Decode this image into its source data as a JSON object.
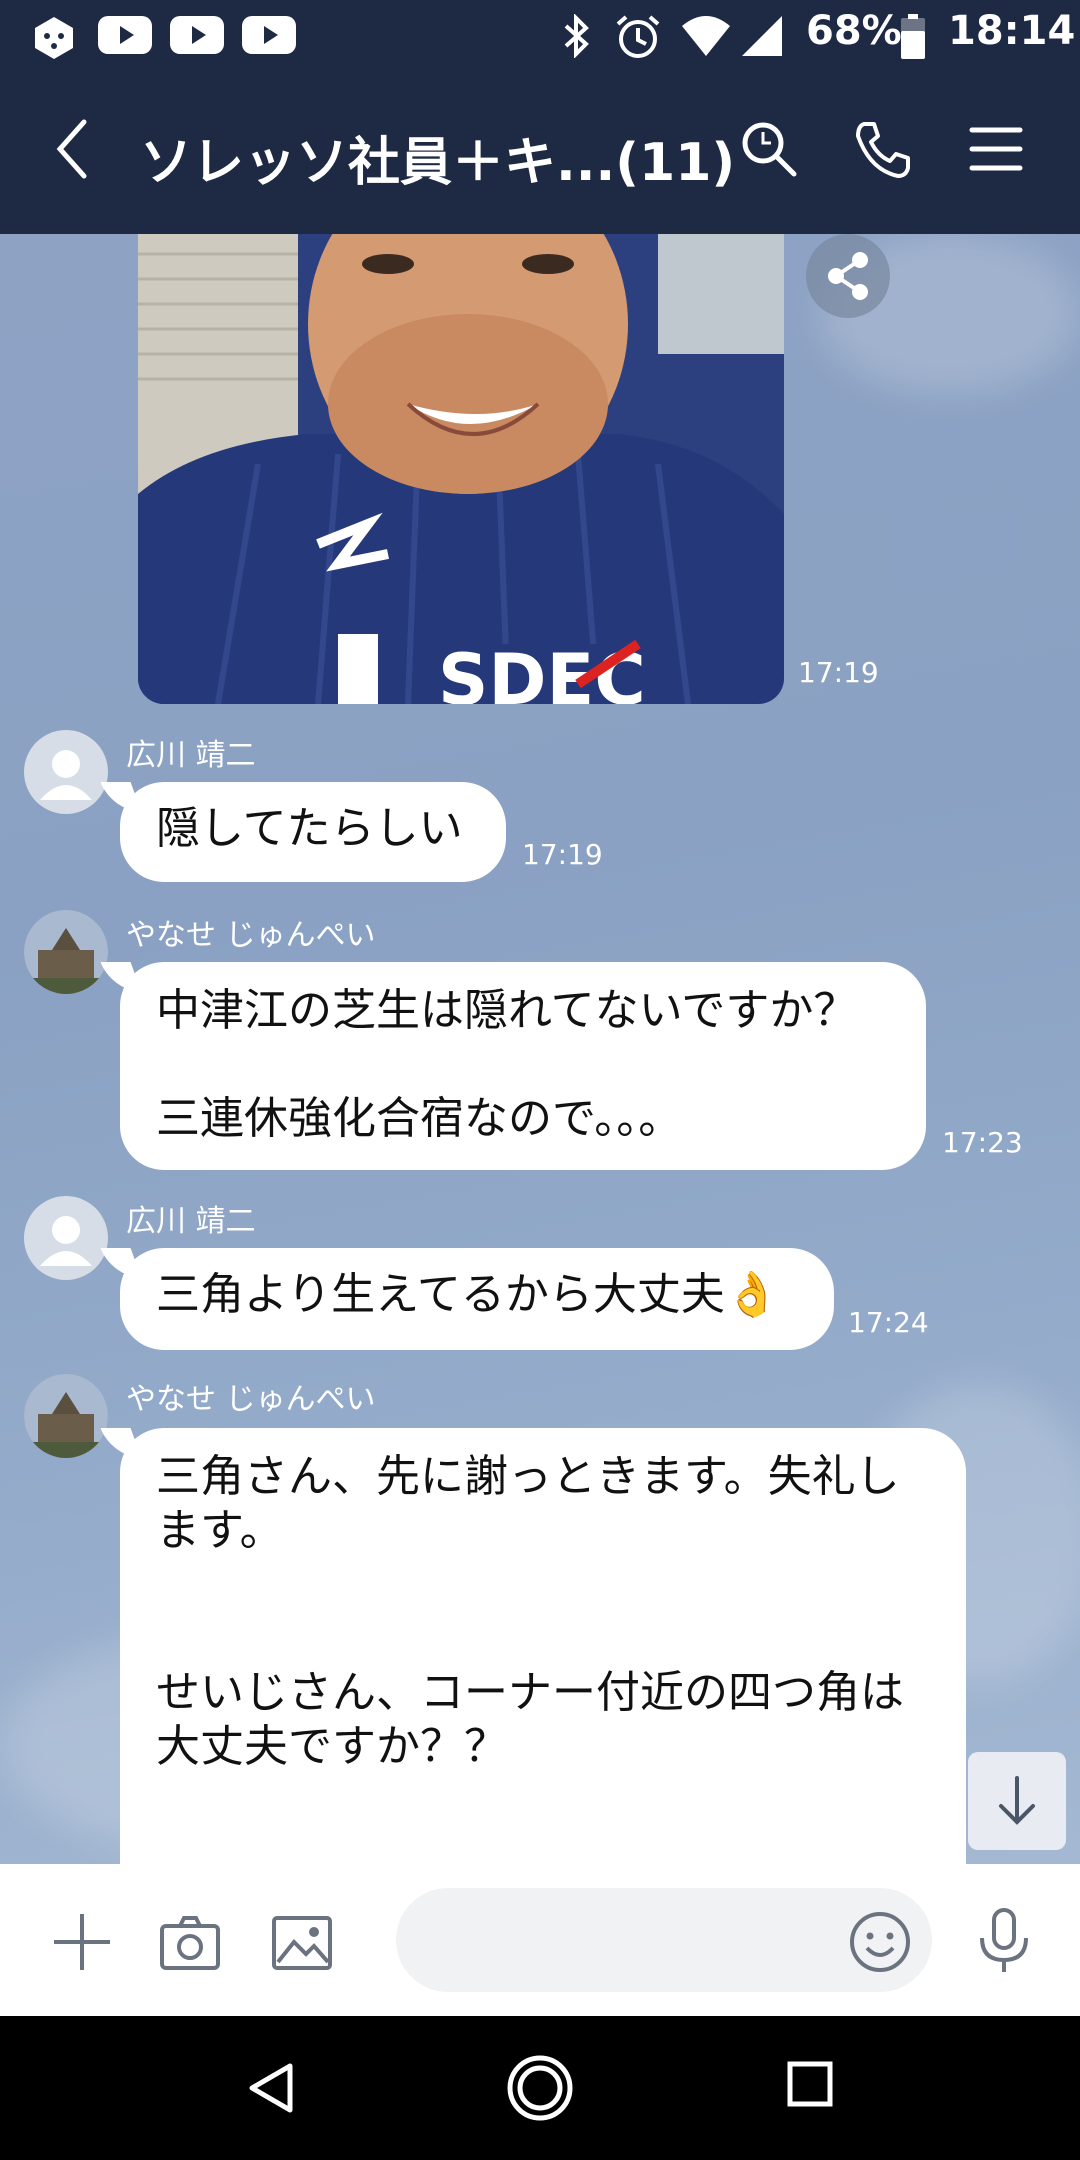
{
  "status_bar": {
    "battery_percent": "68%",
    "time": "18:14",
    "icons": [
      "app-icon",
      "youtube-icon",
      "youtube-icon",
      "youtube-icon",
      "bluetooth-icon",
      "alarm-icon",
      "wifi-icon",
      "signal-icon",
      "battery-icon"
    ]
  },
  "header": {
    "title": "ソレッソ社員＋キ...(11)",
    "icons": [
      "back-icon",
      "search-icon",
      "phone-icon",
      "menu-icon"
    ]
  },
  "messages": [
    {
      "type": "image",
      "time": "17:19"
    },
    {
      "sender": "広川 靖二",
      "text": "隠してたらしい",
      "time": "17:19"
    },
    {
      "sender": "やなせ じゅんぺい",
      "text_line1": "中津江の芝生は隠れてないですか？",
      "text_line2": "三連休強化合宿なので。。。",
      "time": "17:23"
    },
    {
      "sender": "広川 靖二",
      "text": "三角より生えてるから大丈夫",
      "emoji": "👌",
      "time": "17:24"
    },
    {
      "sender": "やなせ じゅんぺい",
      "text_line1": "三角さん、先に謝っときます。失礼し",
      "text_line2": "ます。",
      "text_line3": "せいじさん、コーナー付近の四つ角は",
      "text_line4": "大丈夫ですか？？"
    }
  ],
  "input_bar": {
    "icons": [
      "plus-icon",
      "camera-icon",
      "image-icon",
      "emoji-icon",
      "mic-icon"
    ]
  },
  "nav_bar": {
    "icons": [
      "nav-back-icon",
      "nav-home-icon",
      "nav-recents-icon"
    ]
  },
  "colors": {
    "header_bg": "#1e2a44",
    "chat_bg": "#8ea3c4",
    "bubble": "#ffffff"
  }
}
